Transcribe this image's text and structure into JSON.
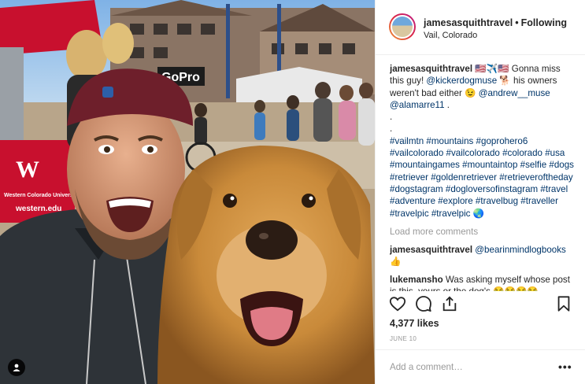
{
  "header": {
    "username": "jamesasquithtravel",
    "separator": "•",
    "follow_status": "Following",
    "location": "Vail, Colorado"
  },
  "caption": {
    "username": "jamesasquithtravel",
    "text_1": "🇺🇸✈️🇺🇸 Gonna miss this guy! ",
    "mention_1": "@kickerdogmuse",
    "text_2": " 🐕 his owners weren't bad either 😉 ",
    "mention_2": "@andrew__muse",
    "text_3": " ",
    "mention_3": "@alamarre11",
    "text_4": " .\n.\n.\n",
    "hashtags": "#vailmtn #mountains #goprohero6 #vailcolorado #vailcolorado #colorado #usa #mountaingames #mountaintop #selfie #dogs #retriever #goldenretriever #retrieveroftheday #dogstagram #dogloversofinstagram #travel #adventure #explore #travelbug #traveller #travelpic #travelpic",
    "emoji_end": " 🌏"
  },
  "load_more": "Load more comments",
  "comments": [
    {
      "username": "jamesasquithtravel",
      "mention": "@bearinmindlogbooks",
      "text": " 👍"
    },
    {
      "username": "lukemansho",
      "mention": "",
      "text": " Was asking myself whose post is this, yours or the dog's 😂😂😂😂"
    }
  ],
  "actions": {
    "like_icon": "heart-icon",
    "comment_icon": "comment-icon",
    "share_icon": "share-icon",
    "save_icon": "bookmark-icon"
  },
  "likes": "4,377 likes",
  "date": "JUNE 10",
  "add_comment": {
    "placeholder": "Add a comment…",
    "more": "•••"
  },
  "photo": {
    "banner_text_1": "GoPro",
    "banner_text_2": "Western Colorado University",
    "banner_text_3": "western.edu",
    "tag_icon": "user-tag-icon"
  },
  "colors": {
    "link": "#003569",
    "muted": "#999999",
    "text": "#262626",
    "tent_red": "#c8102e",
    "dog_gold": "#c98a3a"
  }
}
